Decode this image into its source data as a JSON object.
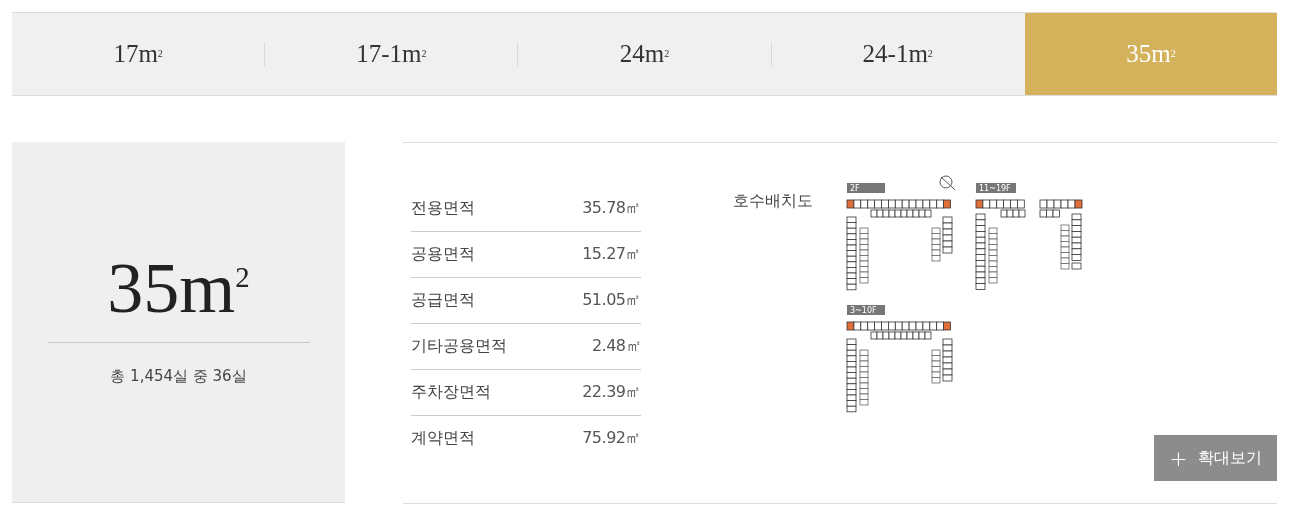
{
  "tabs": [
    {
      "label": "17m$^{2}$",
      "selected": false
    },
    {
      "label": "17-1m$^{2}$",
      "selected": false
    },
    {
      "label": "24m$^{2}$",
      "selected": false
    },
    {
      "label": "24-1m$^{2}$",
      "selected": false
    },
    {
      "label": "35m$^{2}$",
      "selected": true
    }
  ],
  "summary": {
    "size": "35m$^{2}$",
    "count": "총 1,454실 중 36실"
  },
  "areas": [
    {
      "label": "전용면적",
      "value": "35.78㎡"
    },
    {
      "label": "공용면적",
      "value": "15.27㎡"
    },
    {
      "label": "공급면적",
      "value": "51.05㎡"
    },
    {
      "label": "기타공용면적",
      "value": "2.48㎡"
    },
    {
      "label": "주차장면적",
      "value": "22.39㎡"
    },
    {
      "label": "계약면적",
      "value": "75.92㎡"
    }
  ],
  "layout": {
    "title": "호수배치도",
    "plans": [
      {
        "floor": "2F",
        "kind": "full"
      },
      {
        "floor": "11~19F",
        "kind": "split"
      },
      {
        "floor": "3~10F",
        "kind": "full_extra"
      }
    ],
    "button": {
      "icon": "+",
      "label": "확대보기"
    }
  }
}
